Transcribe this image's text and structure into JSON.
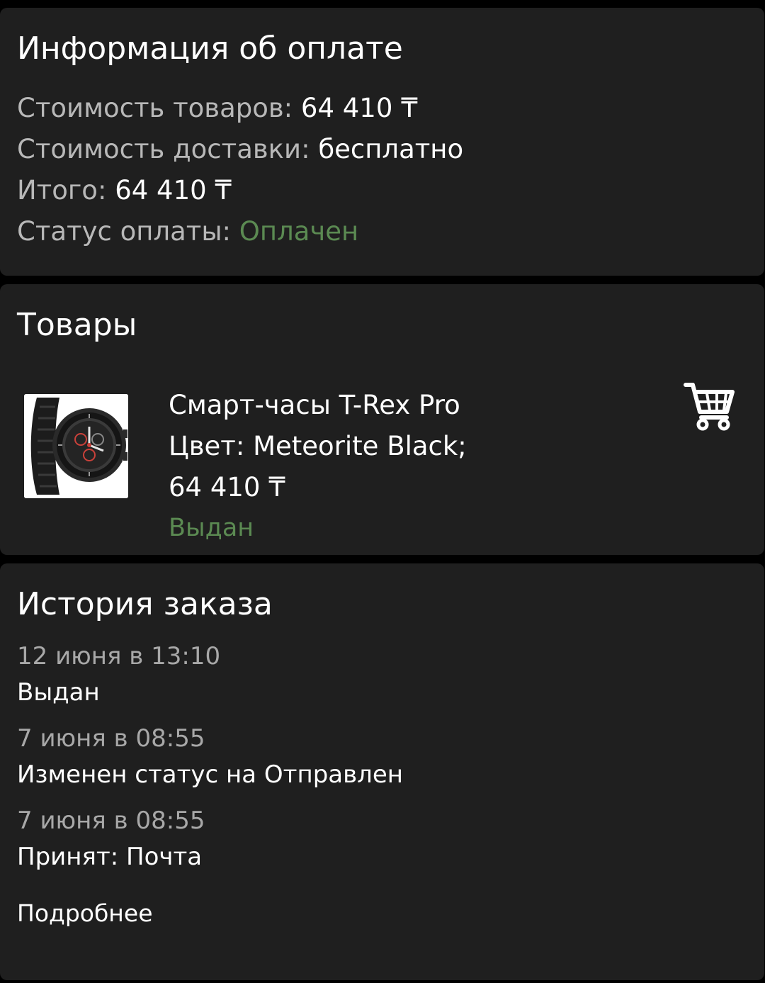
{
  "payment": {
    "title": "Информация об оплате",
    "goods_cost_label": "Стоимость товаров:",
    "goods_cost_value": "64 410 ₸",
    "delivery_label": "Стоимость доставки:",
    "delivery_value": "бесплатно",
    "total_label": "Итого:",
    "total_value": "64 410 ₸",
    "status_label": "Статус оплаты:",
    "status_value": "Оплачен"
  },
  "goods": {
    "title": "Товары",
    "items": [
      {
        "name": "Смарт-часы T-Rex Pro",
        "color": "Цвет: Meteorite Black;",
        "price": "64 410 ₸",
        "status": "Выдан",
        "icon": "cart-icon"
      }
    ]
  },
  "history": {
    "title": "История заказа",
    "items": [
      {
        "date": "12 июня в 13:10",
        "text": "Выдан"
      },
      {
        "date": "7 июня в 08:55",
        "text": "Изменен статус на Отправлен"
      },
      {
        "date": "7 июня в 08:55",
        "text": "Принят: Почта"
      }
    ],
    "more_label": "Подробнее"
  },
  "colors": {
    "background": "#000000",
    "card": "#1f1f1f",
    "muted_text": "#b8b8b8",
    "success_green": "#5b8a52"
  }
}
